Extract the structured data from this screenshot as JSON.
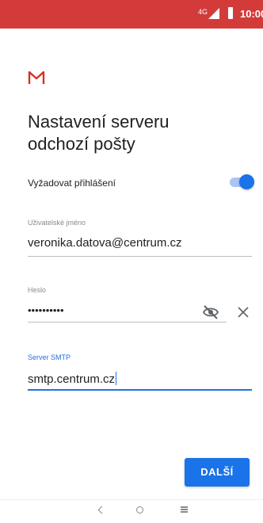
{
  "status_bar": {
    "network": "4G",
    "time": "10:00",
    "color": "#d33b3b"
  },
  "app": {
    "logo_icon": "gmail-m-icon",
    "logo_color": "#d93025"
  },
  "title": {
    "line1": "Nastavení serveru",
    "line2": "odchozí pošty"
  },
  "require_login": {
    "label": "Vyžadovat přihlášení",
    "enabled": true,
    "accent": "#1a73e8"
  },
  "username": {
    "label": "Uživatelské jméno",
    "value": "veronika.datova@centrum.cz"
  },
  "password": {
    "label": "Heslo",
    "value": "••••••••••",
    "visibility_icon": "eye-off-icon",
    "clear_icon": "close-icon"
  },
  "smtp_server": {
    "label": "Server SMTP",
    "value": "smtp.centrum.cz",
    "focused": true
  },
  "next_button": {
    "label": "DALŠÍ"
  },
  "nav_bar": {
    "back_icon": "back-icon",
    "home_icon": "home-icon",
    "recents_icon": "recents-icon"
  }
}
